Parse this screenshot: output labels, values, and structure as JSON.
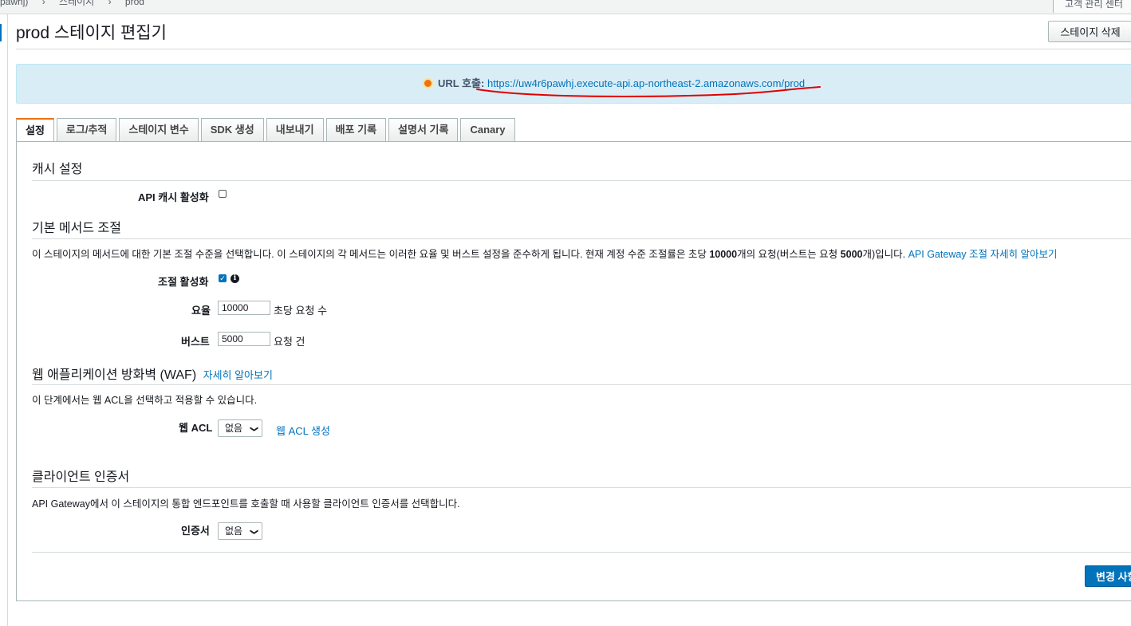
{
  "breadcrumb": {
    "items": [
      "pawhj)",
      "스테이지",
      "prod"
    ],
    "right_text": "고객 관리 센터"
  },
  "header": {
    "title": "prod 스테이지 편집기",
    "delete_button": "스테이지 삭제"
  },
  "invoke_url": {
    "label": "URL 호출:",
    "url": "https://uw4r6pawhj.execute-api.ap-northeast-2.amazonaws.com/prod"
  },
  "tabs": [
    {
      "label": "설정",
      "active": true
    },
    {
      "label": "로그/추적"
    },
    {
      "label": "스테이지 변수"
    },
    {
      "label": "SDK 생성"
    },
    {
      "label": "내보내기"
    },
    {
      "label": "배포 기록"
    },
    {
      "label": "설명서 기록"
    },
    {
      "label": "Canary"
    }
  ],
  "cache": {
    "title": "캐시 설정",
    "enable_label": "API 캐시 활성화",
    "enabled": false
  },
  "throttling": {
    "title": "기본 메서드 조절",
    "desc_part1": "이 스테이지의 메서드에 대한 기본 조절 수준을 선택합니다. 이 스테이지의 각 메서드는 이러한 요율 및 버스트 설정을 준수하게 됩니다. 현재 계정 수준 조절률은 초당 ",
    "desc_rate": "10000",
    "desc_part2": "개의 요청(버스트는 요청 ",
    "desc_burst": "5000",
    "desc_part3": "개)입니다. ",
    "desc_link": "API Gateway 조절 자세히 알아보기",
    "enable_label": "조절 활성화",
    "enabled": true,
    "rate_label": "요율",
    "rate_value": "10000",
    "rate_unit": "초당 요청 수",
    "burst_label": "버스트",
    "burst_value": "5000",
    "burst_unit": "요청 건"
  },
  "waf": {
    "title": "웹 애플리케이션 방화벽 (WAF)",
    "learn_more": "자세히 알아보기",
    "desc": "이 단계에서는 웹 ACL을 선택하고 적용할 수 있습니다.",
    "acl_label": "웹 ACL",
    "acl_value": "없음",
    "create_link": "웹 ACL 생성"
  },
  "client_cert": {
    "title": "클라이언트 인증서",
    "desc": "API Gateway에서 이 스테이지의 통합 엔드포인트를 호출할 때 사용할 클라이언트 인증서를 선택합니다.",
    "cert_label": "인증서",
    "cert_value": "없음"
  },
  "save_button": "변경 사항 저장",
  "colors": {
    "accent": "#ec7211",
    "link": "#0073bb",
    "info_bg": "#d9edf7",
    "annotation": "#e00000"
  },
  "icons": {
    "url_status": "status-dot-icon",
    "info": "info-icon",
    "dropdown": "chevron-down-icon"
  }
}
